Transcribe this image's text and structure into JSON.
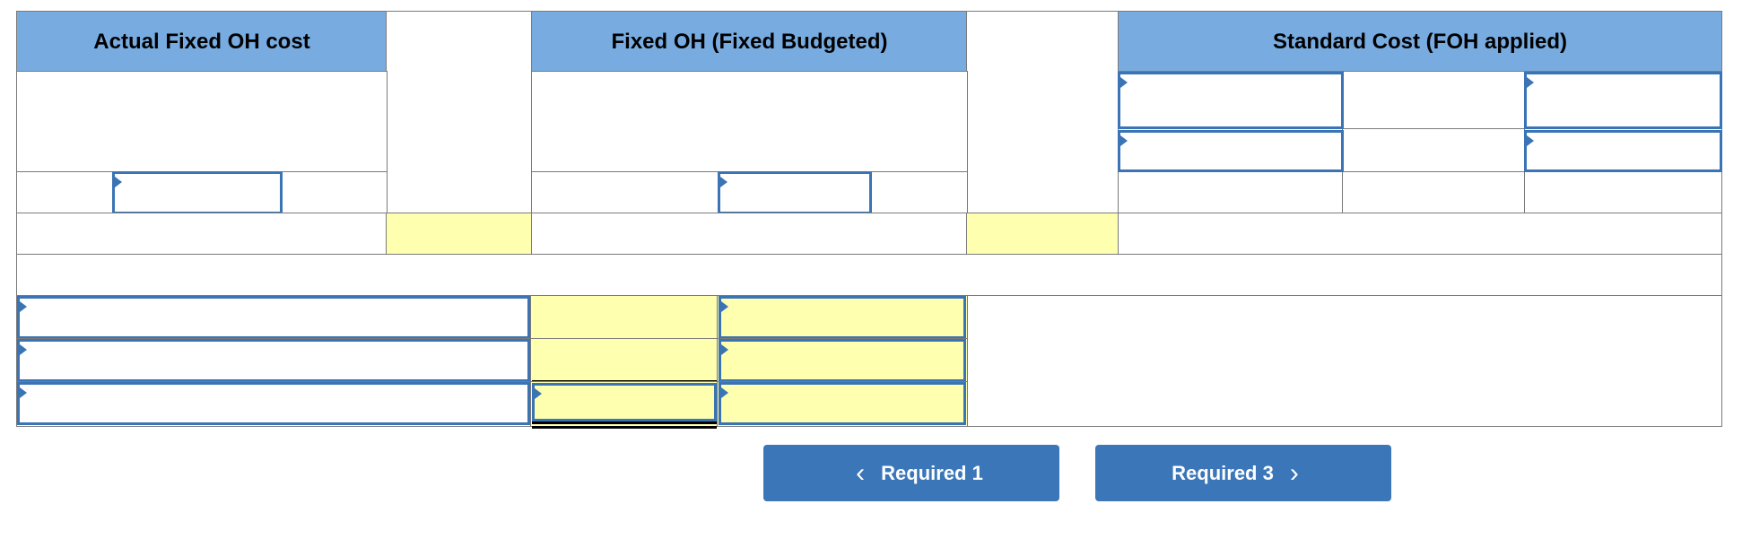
{
  "table": {
    "headers": {
      "actual": "Actual Fixed OH cost",
      "budgeted": "Fixed OH (Fixed Budgeted)",
      "standard": "Standard Cost (FOH applied)"
    },
    "colors": {
      "header_bg": "#78ace1",
      "computed_cell_bg": "#ffffb0",
      "input_border": "#3a74b5"
    }
  },
  "navigation": {
    "prev_label": "Required 1",
    "next_label": "Required 3",
    "prev_icon": "chevron-left-icon",
    "next_icon": "chevron-right-icon",
    "button_color": "#3a76b8"
  }
}
